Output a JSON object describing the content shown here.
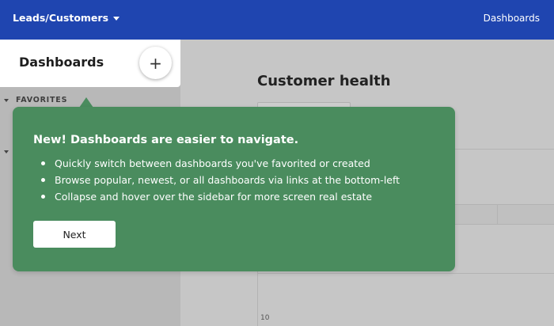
{
  "topbar": {
    "breadcrumb": "Leads/Customers",
    "right_link": "Dashboards"
  },
  "sidebar": {
    "title": "Dashboards",
    "add_label": "+",
    "favorites_label": "FAVORITES"
  },
  "main": {
    "page_title": "Customer health",
    "axis_tick": "10"
  },
  "popover": {
    "title": "New! Dashboards are easier to navigate.",
    "bullets": [
      "Quickly switch between dashboards you've favorited or created",
      "Browse popular, newest, or all dashboards via links at the bottom-left",
      "Collapse and hover over the sidebar for more screen real estate"
    ],
    "next_label": "Next"
  },
  "colors": {
    "topbar": "#1f45b0",
    "popover": "#4a8c5e"
  }
}
